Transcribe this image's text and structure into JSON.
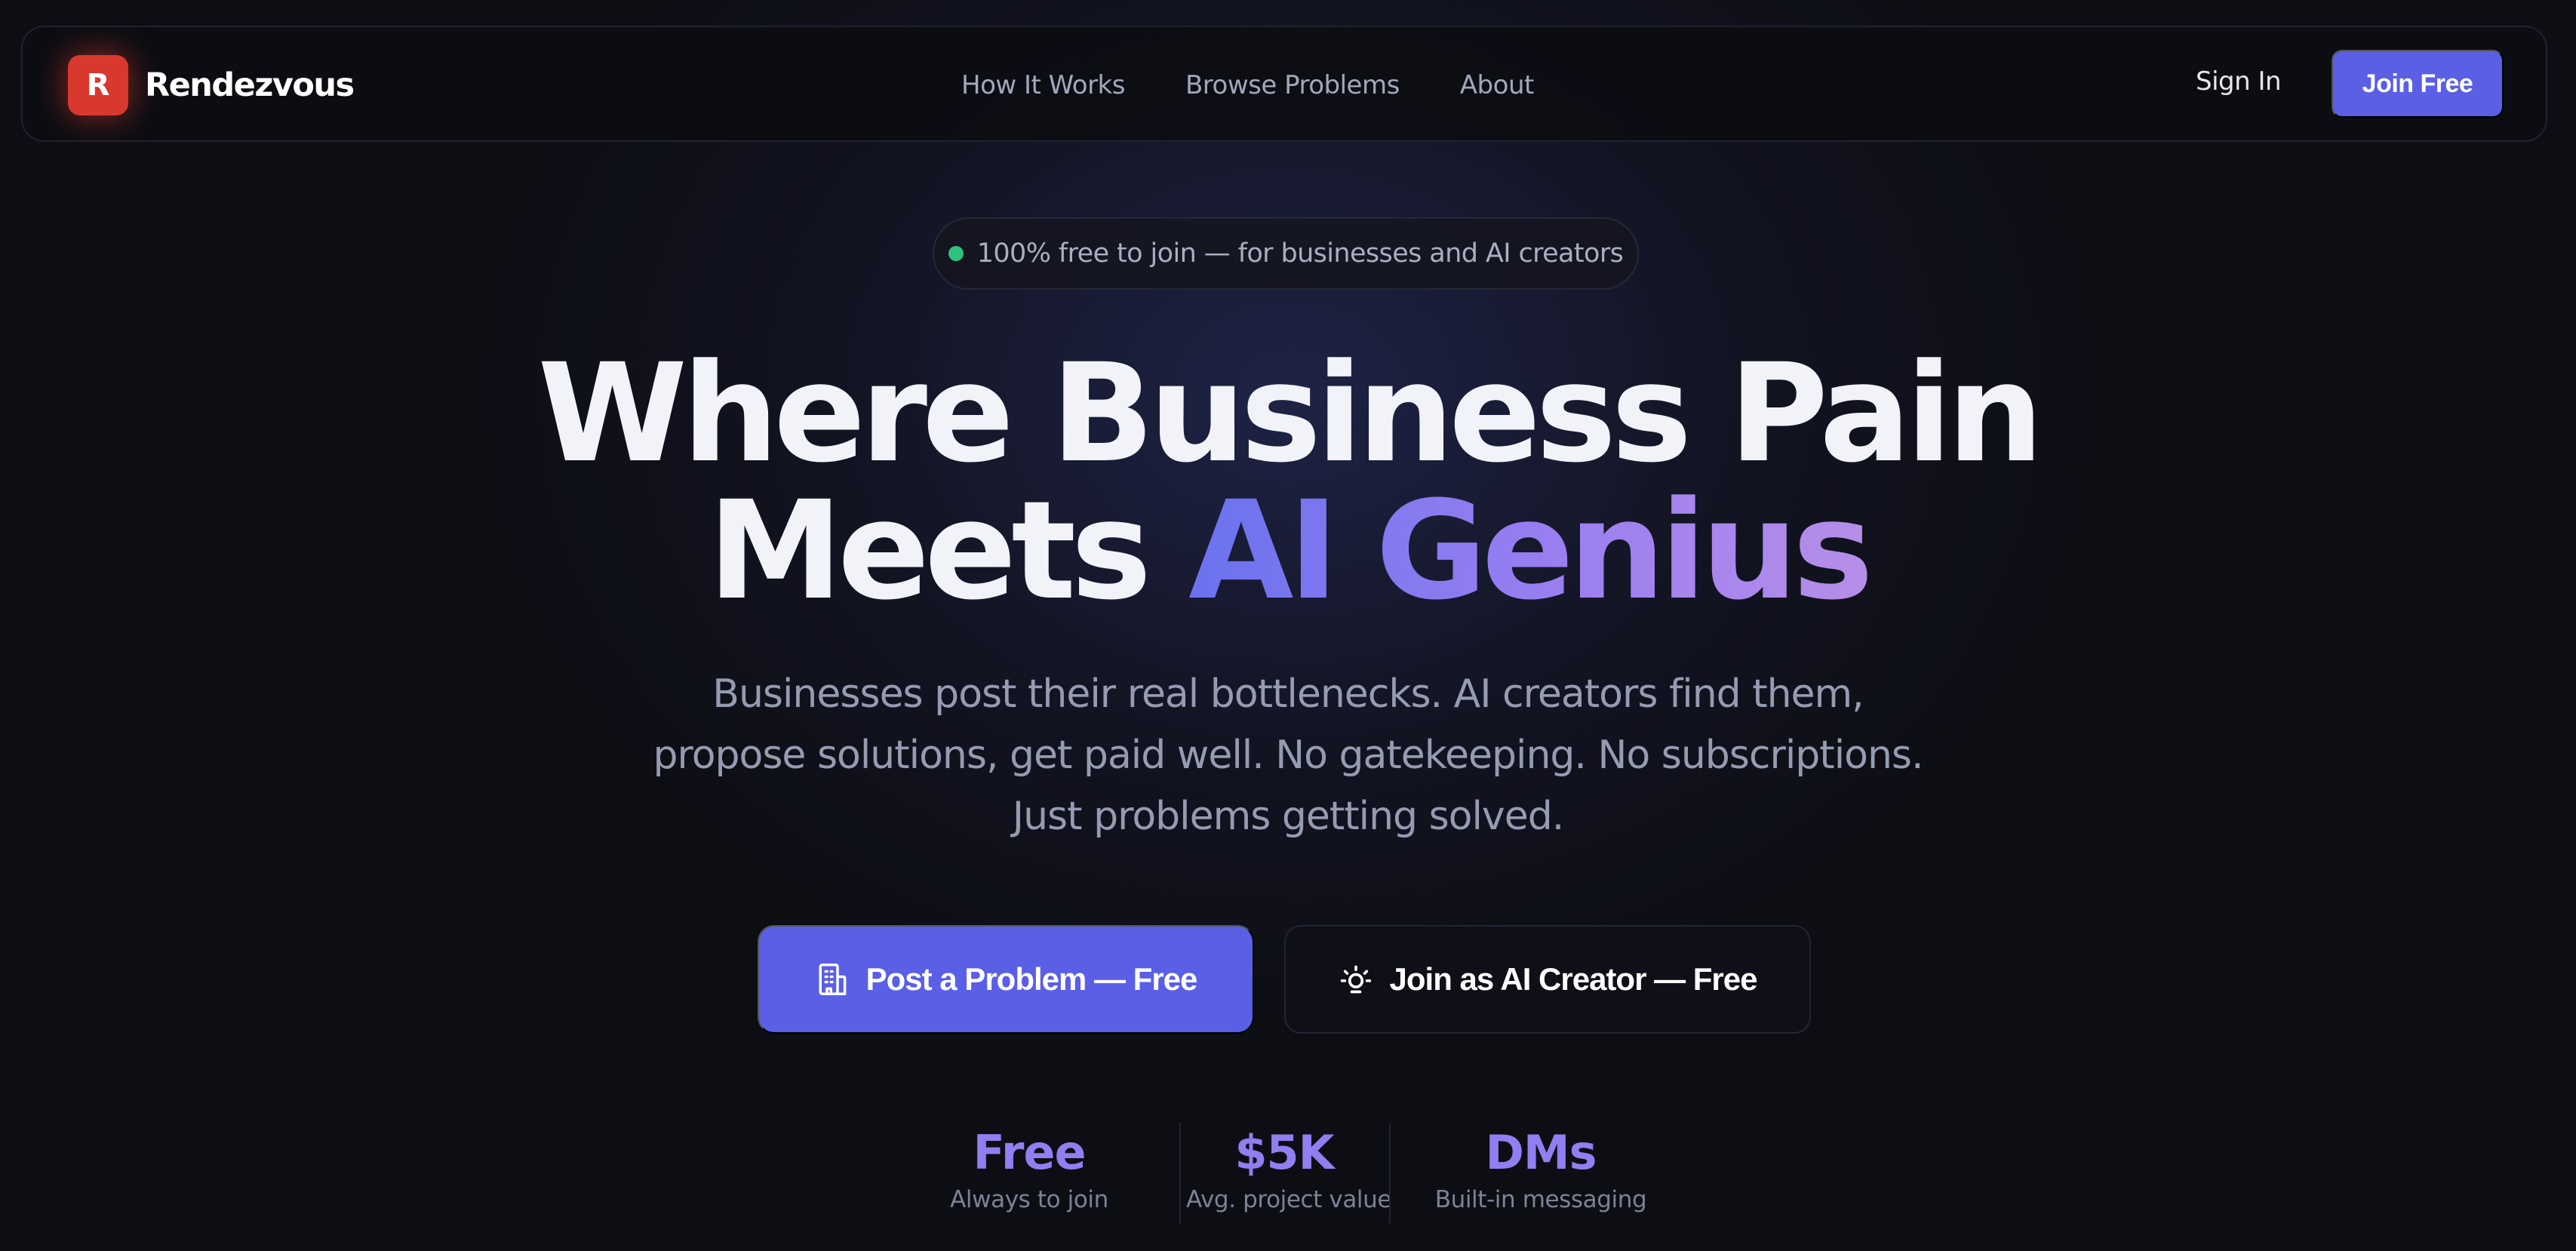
{
  "nav": {
    "logo_letter": "R",
    "brand_name": "Rendezvous",
    "links": [
      "How It Works",
      "Browse Problems",
      "About"
    ],
    "sign_in": "Sign In",
    "join_button": "Join Free"
  },
  "badge": {
    "text": "100% free to join — for businesses and AI creators"
  },
  "hero": {
    "title_line1": "Where Business Pain",
    "title_line2_plain": "Meets",
    "title_line2_accent": "AI Genius",
    "subtitle": "Businesses post their real bottlenecks. AI creators find them, propose solutions, get paid well. No gatekeeping. No subscriptions. Just problems getting solved."
  },
  "cta": {
    "primary_label": "Post a Problem — Free",
    "primary_icon": "building-icon",
    "secondary_label": "Join as AI Creator — Free",
    "secondary_icon": "lightbulb-icon"
  },
  "stats": [
    {
      "value": "Free",
      "label": "Always to join"
    },
    {
      "value": "$5K",
      "label": "Avg. project value"
    },
    {
      "value": "DMs",
      "label": "Built-in messaging"
    }
  ],
  "colors": {
    "background": "#0d0e14",
    "accent": "#5a5fe6",
    "logo": "#d9382f",
    "status_dot": "#2fc27e",
    "stat_value": "#8f7ff0"
  }
}
